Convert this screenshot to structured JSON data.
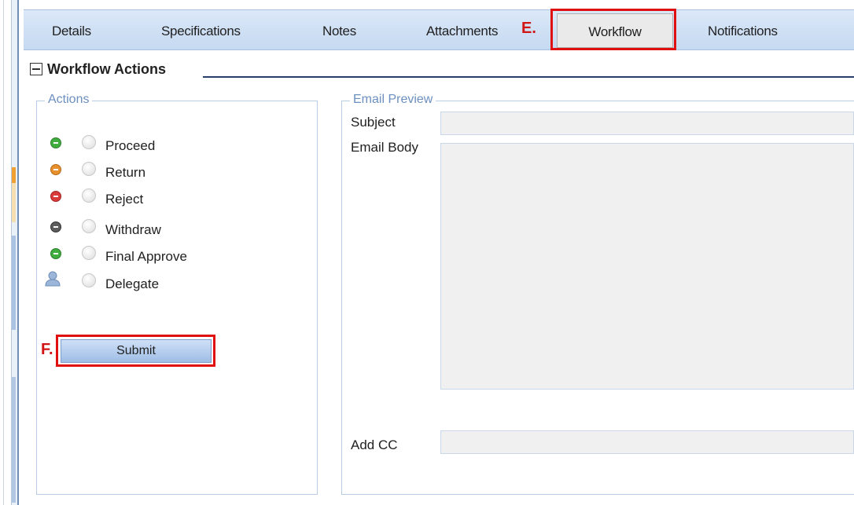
{
  "tabs": [
    {
      "label": "Details"
    },
    {
      "label": "Specifications"
    },
    {
      "label": "Notes"
    },
    {
      "label": "Attachments"
    },
    {
      "label": "Workflow",
      "active": true
    },
    {
      "label": "Notifications"
    }
  ],
  "callouts": {
    "e": "E.",
    "f": "F."
  },
  "section": {
    "title": "Workflow Actions"
  },
  "actions_panel": {
    "legend": "Actions",
    "items": [
      {
        "label": "Proceed",
        "icon": "green-minus-circle-icon",
        "color": "#3fae3f"
      },
      {
        "label": "Return",
        "icon": "orange-minus-circle-icon",
        "color": "#e8902e"
      },
      {
        "label": "Reject",
        "icon": "red-minus-circle-icon",
        "color": "#d93a3a"
      },
      {
        "label": "Withdraw",
        "icon": "gray-minus-circle-icon",
        "color": "#5c5c5c"
      },
      {
        "label": "Final Approve",
        "icon": "green-minus-circle-icon",
        "color": "#3fae3f"
      },
      {
        "label": "Delegate",
        "icon": "user-icon",
        "color": "#7a9cc4"
      }
    ],
    "submit_label": "Submit"
  },
  "email_preview": {
    "legend": "Email Preview",
    "subject_label": "Subject",
    "subject_value": "",
    "body_label": "Email Body",
    "body_value": "",
    "cc_label": "Add CC",
    "cc_value": ""
  },
  "colors": {
    "highlight": "#e01010",
    "tab_bar": "#c5d9f1",
    "legend_text": "#6c8fbf",
    "button": "#9fbde6"
  }
}
